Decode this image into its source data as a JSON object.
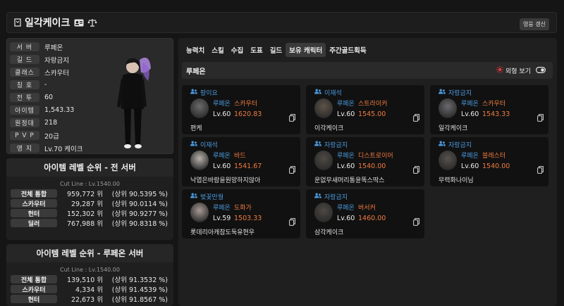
{
  "header": {
    "title": "일각케이크",
    "refresh_label": "영웅 갱신"
  },
  "profile": [
    {
      "label": "서 버",
      "value": "루페온"
    },
    {
      "label": "길 드",
      "value": "자랑금지"
    },
    {
      "label": "클래스",
      "value": "스카우터"
    },
    {
      "label": "칭 호",
      "value": "-"
    },
    {
      "label": "전 투",
      "value": "60"
    },
    {
      "label": "아이템",
      "value": "1,543.33"
    },
    {
      "label": "원정대",
      "value": "218"
    },
    {
      "label": "P V P",
      "value": "20급"
    },
    {
      "label": "영 지",
      "value": "Lv.70 케이크"
    }
  ],
  "ranking_all": {
    "title": "아이템 레벨 순위 - 전 서버",
    "cutline": "Cut Line : Lv.1540.00",
    "rows": [
      {
        "label": "전체 통합",
        "rank": "959,772 위",
        "pct": "(상위 90.5395 %)"
      },
      {
        "label": "스카우터",
        "rank": "29,287 위",
        "pct": "(상위 90.0114 %)"
      },
      {
        "label": "헌터",
        "rank": "152,302 위",
        "pct": "(상위 90.9277 %)"
      },
      {
        "label": "딜러",
        "rank": "767,988 위",
        "pct": "(상위 90.8318 %)"
      }
    ]
  },
  "ranking_server": {
    "title": "아이템 레벨 순위 - 루페온 서버",
    "cutline": "Cut Line : Lv.1540.00",
    "rows": [
      {
        "label": "전체 통합",
        "rank": "139,510 위",
        "pct": "(상위 91.3532 %)"
      },
      {
        "label": "스카우터",
        "rank": "4,334 위",
        "pct": "(상위 91.4539 %)"
      },
      {
        "label": "헌터",
        "rank": "22,673 위",
        "pct": "(상위 91.8567 %)"
      }
    ]
  },
  "tabs": [
    "능력치",
    "스킬",
    "수집",
    "도표",
    "길드",
    "보유 캐릭터",
    "주간골드획득"
  ],
  "active_tab": "보유 캐릭터",
  "server_bar": {
    "name": "루페온",
    "appearance_label": "외형 보기"
  },
  "characters": [
    {
      "guild": "팡이요",
      "server": "루페온",
      "class": "스카우터",
      "level": "Lv.60",
      "item_level": "1620.83",
      "name": "편케"
    },
    {
      "guild": "이재석",
      "server": "루페온",
      "class": "스트라이커",
      "level": "Lv.60",
      "item_level": "1545.00",
      "name": "이각케이크"
    },
    {
      "guild": "자랑금지",
      "server": "루페온",
      "class": "스카우터",
      "level": "Lv.60",
      "item_level": "1543.33",
      "name": "일각케이크"
    },
    {
      "guild": "이재석",
      "server": "루페온",
      "class": "바드",
      "level": "Lv.60",
      "item_level": "1541.67",
      "name": "낙엽은바람을원망하지않아"
    },
    {
      "guild": "자랑금지",
      "server": "루페온",
      "class": "디스트로이어",
      "level": "Lv.60",
      "item_level": "1540.00",
      "name": "운없무새머리통윤똑스딱스"
    },
    {
      "guild": "자랑금지",
      "server": "루페온",
      "class": "블레스터",
      "level": "Lv.60",
      "item_level": "1540.00",
      "name": "무력화나이님"
    },
    {
      "guild": "벚꽃만월",
      "server": "루페온",
      "class": "도화가",
      "level": "Lv.59",
      "item_level": "1503.33",
      "name": "롯데리아캐참도둑유현우"
    },
    {
      "guild": "자랑금지",
      "server": "루페온",
      "class": "버서커",
      "level": "Lv.60",
      "item_level": "1460.00",
      "name": "삼각케이크"
    }
  ],
  "colors": {
    "guild_blue": "#4a9adf",
    "accent_orange": "#f07b3f",
    "toggle_red": "#e43b3b"
  }
}
